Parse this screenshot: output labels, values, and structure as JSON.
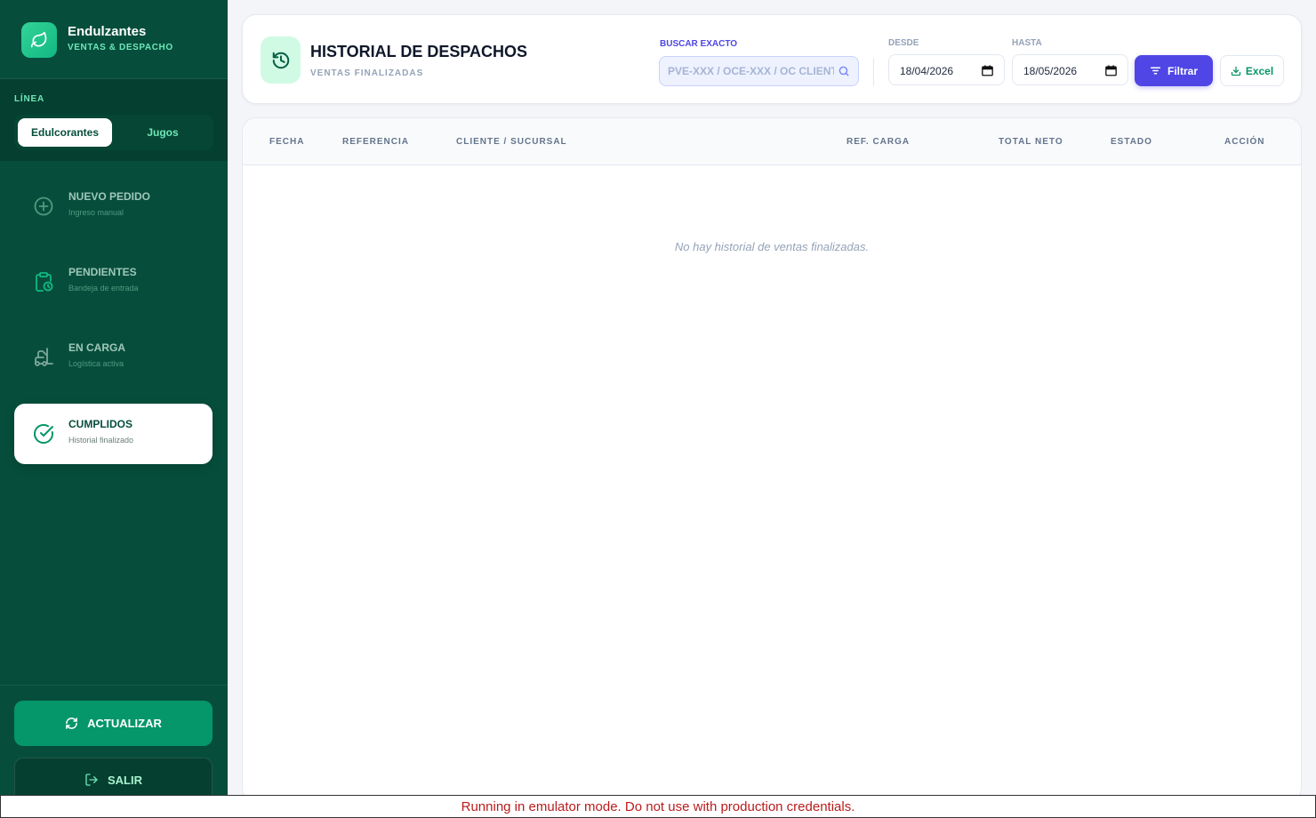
{
  "brand": {
    "title": "Endulzantes",
    "subtitle": "VENTAS & DESPACHO"
  },
  "line": {
    "label": "LÍNEA",
    "options": [
      "Edulcorantes",
      "Jugos"
    ],
    "selected": "Edulcorantes"
  },
  "nav": [
    {
      "title": "NUEVO PEDIDO",
      "subtitle": "Ingreso manual",
      "icon": "plus-circle-icon",
      "active": false
    },
    {
      "title": "PENDIENTES",
      "subtitle": "Bandeja de entrada",
      "icon": "clipboard-clock-icon",
      "active": false
    },
    {
      "title": "EN CARGA",
      "subtitle": "Logística activa",
      "icon": "forklift-icon",
      "active": false
    },
    {
      "title": "CUMPLIDOS",
      "subtitle": "Historial finalizado",
      "icon": "check-circle-icon",
      "active": true
    }
  ],
  "footer": {
    "refresh_label": "ACTUALIZAR",
    "exit_label": "SALIR"
  },
  "header": {
    "title": "HISTORIAL DE DESPACHOS",
    "subtitle": "VENTAS FINALIZADAS",
    "search_label": "BUSCAR EXACTO",
    "search_placeholder": "PVE-XXX / OCE-XXX / OC CLIENTE",
    "from_label": "DESDE",
    "from_value": "18/04/2026",
    "to_label": "HASTA",
    "to_value": "18/05/2026",
    "filter_label": "Filtrar",
    "excel_label": "Excel"
  },
  "table": {
    "columns": [
      "FECHA",
      "REFERENCIA",
      "CLIENTE / SUCURSAL",
      "REF. CARGA",
      "TOTAL NETO",
      "ESTADO",
      "ACCIÓN"
    ],
    "rows": [],
    "empty_message": "No hay historial de ventas finalizadas."
  },
  "banner": {
    "text": "Running in emulator mode. Do not use with production credentials."
  },
  "colors": {
    "sidebar": "#064e3b",
    "accent": "#059669",
    "primary": "#4f46e5",
    "banner_text": "#b91c1c"
  }
}
